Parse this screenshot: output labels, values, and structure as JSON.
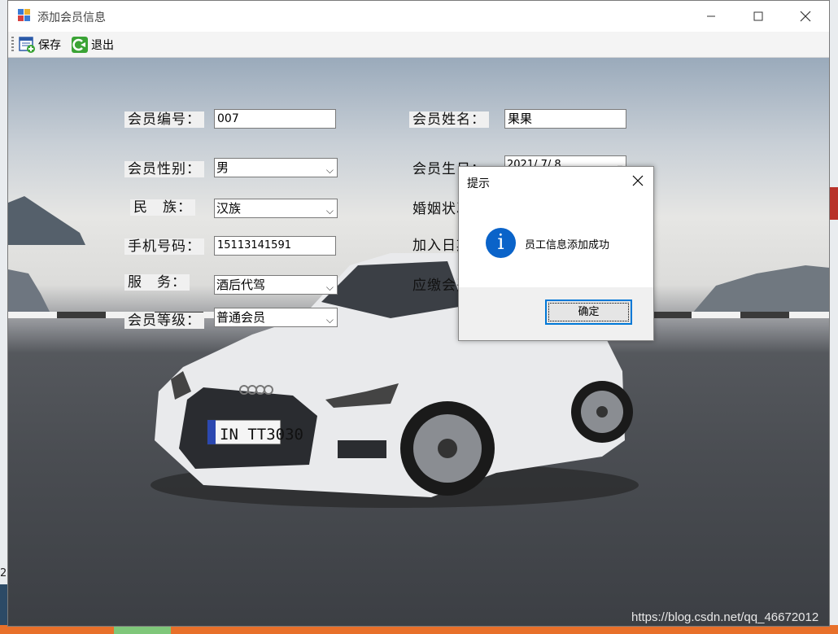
{
  "window": {
    "title": "添加会员信息"
  },
  "toolbar": {
    "save_label": "保存",
    "exit_label": "退出"
  },
  "form": {
    "member_id_label": "会员编号：",
    "member_id_value": "007",
    "member_name_label": "会员姓名：",
    "member_name_value": "果果",
    "gender_label": "会员性别：",
    "gender_value": "男",
    "birthday_label": "会员生日：",
    "birthday_value": "2021/ 7/ 8",
    "ethnicity_label": "民　族：",
    "ethnicity_value": "汉族",
    "marital_label": "婚姻状况：",
    "phone_label": "手机号码：",
    "phone_value": "15113141591",
    "join_date_label": "加入日期：",
    "service_label": "服　务：",
    "service_value": "酒后代驾",
    "fee_label": "应缴会费：",
    "level_label": "会员等级：",
    "level_value": "普通会员"
  },
  "dialog": {
    "title": "提示",
    "message": "员工信息添加成功",
    "ok_label": "确定",
    "icon": "information-icon"
  },
  "car": {
    "plate": "IN TT3030"
  },
  "background": {
    "left_edge_number": "2"
  },
  "watermark": "https://blog.csdn.net/qq_46672012"
}
